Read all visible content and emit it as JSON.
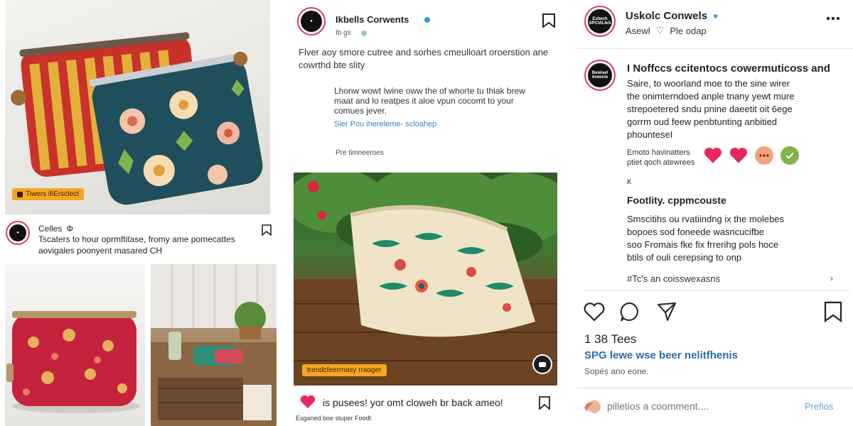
{
  "col1": {
    "photo_tag": "Tiwers ifiErsctect",
    "user": {
      "name": "Celles",
      "glyph": "Φ"
    },
    "caption": [
      "Tscaters to hour oprmftitase, fromy ame pomecattes",
      "aovigales poonyent masared CH"
    ]
  },
  "col2": {
    "user": {
      "name": "Ikbells Corwents",
      "sub": "Ib g̱s"
    },
    "caption": [
      "Flver aoy smore cutree and sorhes cmeulloart oroerstion ane",
      "cowrthd bte slity"
    ],
    "quote": [
      "Lhonw wowt Iwine oww the of whorte tu thiak brew",
      "maat and lo reatpes it aloe vpun cocomt to your",
      "comues jever."
    ],
    "link": "Sier Pou ihereleme- ѕcloahep",
    "small_label": "Pre timneeroes",
    "photo_tag": "trendcfeerrnasy rraoger",
    "bottom_text": "is pusees! yor omt cloweh br back ameo!",
    "footnote": "Esganed boe stuper Foodl:"
  },
  "col3": {
    "user": {
      "name": "Uskolc Conwels",
      "sub_a": "Asewl",
      "sub_b": "Ple odap"
    },
    "avatar_text": [
      "Estwch",
      "SPCIALIeS"
    ],
    "avatar2_text": [
      "Bewisel",
      "tnwocle"
    ],
    "post_title": "I Noffccs ccitentocs cowermuticoss and",
    "post_body": [
      "Saire, to woorland moe to the sine wirer",
      "the onimterndoed anple tnany yewt mure",
      "strepoetered sndu pnine daeetit oit 6ege",
      "gorrm oud feew penbtunting anbitied",
      "phounteseI"
    ],
    "emote_text": [
      "Emoto havinatters",
      "ptiet qoch atewrees"
    ],
    "glyph": "ĸ",
    "section_title": "Footlity. cppmcouste",
    "section_body": [
      "Smscitihs ou rvatiindng ix the molebes",
      "bopoes sod foneede wasncucifbe",
      "soo Fromais fke fix frrerihg pols hoce",
      "btils of ouli cerepsing to onp"
    ],
    "hashtags": "#Tc's an coisswexasns",
    "likes": "1 38 Tees",
    "liked_by": "SPG lewe wse beer nelitfhenis",
    "time": "Sopéș ano eone.",
    "comment_placeholder": "pilletios a coomment....",
    "post_label": "Prefios"
  },
  "colors": {
    "heart": "#e8265e",
    "link_blue": "#2a6da8",
    "verified": "#3aa0d8",
    "tag_orange": "#f5a623"
  }
}
